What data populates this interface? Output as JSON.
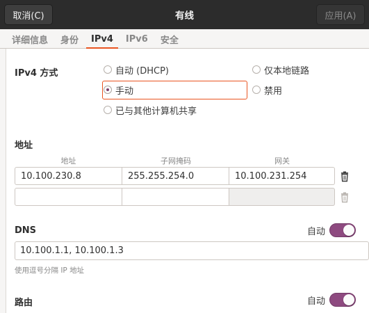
{
  "header": {
    "cancel_label": "取消(C)",
    "title": "有线",
    "apply_label": "应用(A)"
  },
  "tabs": [
    {
      "label": "详细信息",
      "active": false
    },
    {
      "label": "身份",
      "active": false
    },
    {
      "label": "IPv4",
      "active": true
    },
    {
      "label": "IPv6",
      "active": false
    },
    {
      "label": "安全",
      "active": false
    }
  ],
  "ipv4_method": {
    "label": "IPv4 方式",
    "options": {
      "auto_dhcp": "自动 (DHCP)",
      "link_local": "仅本地链路",
      "manual": "手动",
      "disabled": "禁用",
      "shared": "已与其他计算机共享"
    },
    "selected": "manual"
  },
  "addresses": {
    "label": "地址",
    "columns": [
      "地址",
      "子网掩码",
      "网关"
    ],
    "rows": [
      {
        "address": "10.100.230.8",
        "netmask": "255.255.254.0",
        "gateway": "10.100.231.254"
      },
      {
        "address": "",
        "netmask": "",
        "gateway": ""
      }
    ]
  },
  "dns": {
    "label": "DNS",
    "auto_label": "自动",
    "auto_enabled": true,
    "value": "10.100.1.1, 10.100.1.3",
    "hint": "使用逗号分隔 IP 地址"
  },
  "routes": {
    "label": "路由",
    "auto_label": "自动",
    "auto_enabled": true
  },
  "colors": {
    "accent": "#e95420",
    "toggle": "#8e4a80",
    "headerbar": "#2c2c2c"
  }
}
